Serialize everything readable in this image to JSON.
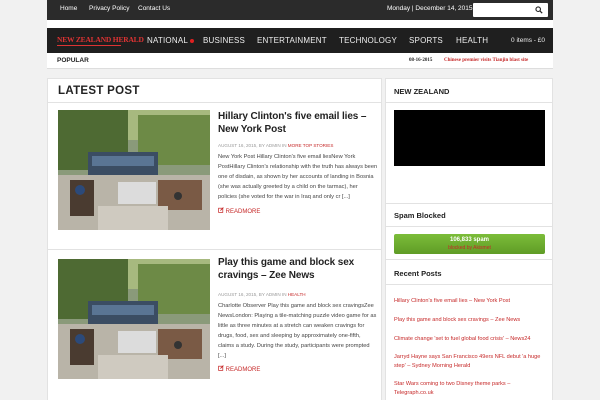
{
  "topbar": {
    "links": [
      "Home",
      "Privacy Policy",
      "Contact Us"
    ],
    "date": "Monday | December 14, 2015",
    "search_icon": "search-icon"
  },
  "nav": {
    "logo": "NEW ZEALAND HERALD",
    "items": [
      "NATIONAL",
      "BUSINESS",
      "ENTERTAINMENT",
      "TECHNOLOGY",
      "SPORTS",
      "HEALTH"
    ],
    "cart": "0 items - £0",
    "accent": "#e02020"
  },
  "popular": {
    "label": "POPULAR",
    "date": "08-16-2015",
    "headline": "Chinese premier visits Tianjin blast site"
  },
  "main": {
    "title": "LATEST POST",
    "posts": [
      {
        "title": "Hillary Clinton's five email lies – New York Post",
        "meta_date": "AUGUST 16, 2015, BY ADMIN IN",
        "category": "MORE TOP STORIES",
        "excerpt": "New York Post Hillary Clinton's five email liesNew York PostHillary Clinton's relationship with the truth has always been one of disdain, as shown by her accounts of landing in Bosnia (she was actually greeted by a child on the tarmac), her policies (she voted for the war in Iraq and only cr [...]",
        "readmore": "READMORE"
      },
      {
        "title": "Play this game and block sex cravings – Zee News",
        "meta_date": "AUGUST 16, 2015, BY ADMIN IN",
        "category": "HEALTH",
        "excerpt": "Charlotte Observer Play this game and block sex cravingsZee NewsLondon: Playing a tile-matching puzzle video game for as little as three minutes at a stretch can weaken cravings for drugs, food, sex and sleeping by approximately one-fifth, claims a study. During the study, participants were prompted [...]",
        "readmore": "READMORE"
      }
    ]
  },
  "sidebar": {
    "nz_title": "NEW ZEALAND",
    "spam_title": "Spam Blocked",
    "spam_count": "106,833 spam",
    "spam_by": "blocked by Akismet",
    "recent_title": "Recent Posts",
    "recent_posts": [
      "Hillary Clinton's five email lies – New York Post",
      "Play this game and block sex cravings – Zee News",
      "Climate change 'set to fuel global food crisis' – News24",
      "Jarryd Hayne says San Francisco 49ers NFL debut 'a huge step' – Sydney Morning Herald",
      "Star Wars coming to two Disney theme parks – Telegraph.co.uk"
    ]
  }
}
